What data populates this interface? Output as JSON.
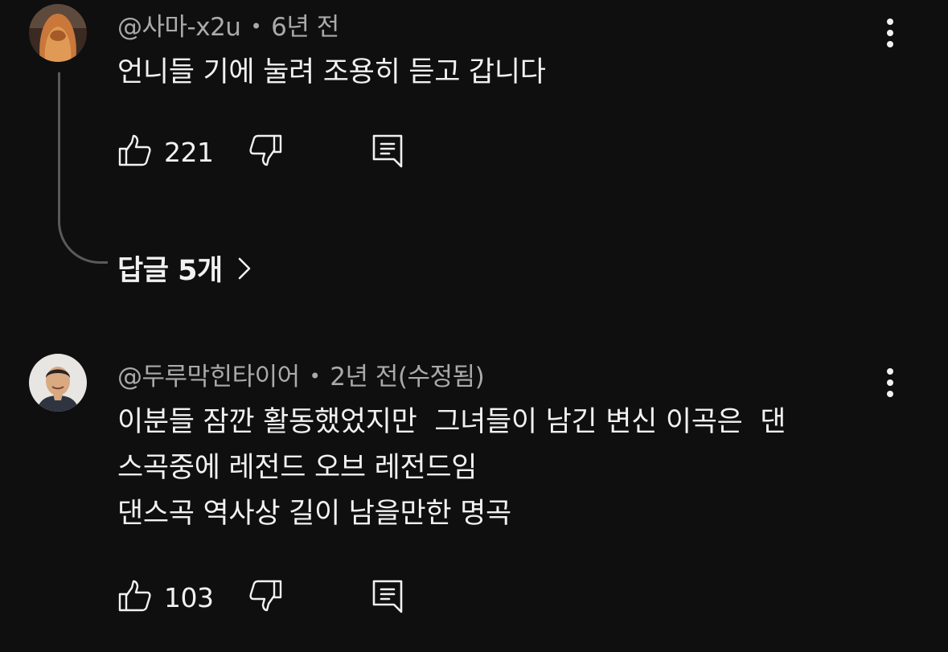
{
  "comments": [
    {
      "author": "@사마-x2u",
      "separator": "•",
      "time": "6년 전",
      "text": "언니들 기에 눌려 조용히 듣고 갑니다",
      "like_count": "221",
      "avatar_icon": "user-avatar-long-hair",
      "menu_icon": "more-vert-icon",
      "replies_label": "답글 5개"
    },
    {
      "author": "@두루막힌타이어",
      "separator": "•",
      "time": "2년 전(수정됨)",
      "text": "이분들 잠깐 활동했었지만  그녀들이 남긴 변신 이곡은  댄\n스곡중에 레전드 오브 레전드임\n댄스곡 역사상 길이 남을만한 명곡",
      "like_count": "103",
      "avatar_icon": "user-avatar-man",
      "menu_icon": "more-vert-icon"
    }
  ],
  "colors": {
    "background": "#0f0f0f",
    "primary_text": "#f1f1f1",
    "secondary_text": "#aaaaaa",
    "thread_line": "#5a5a5a"
  }
}
